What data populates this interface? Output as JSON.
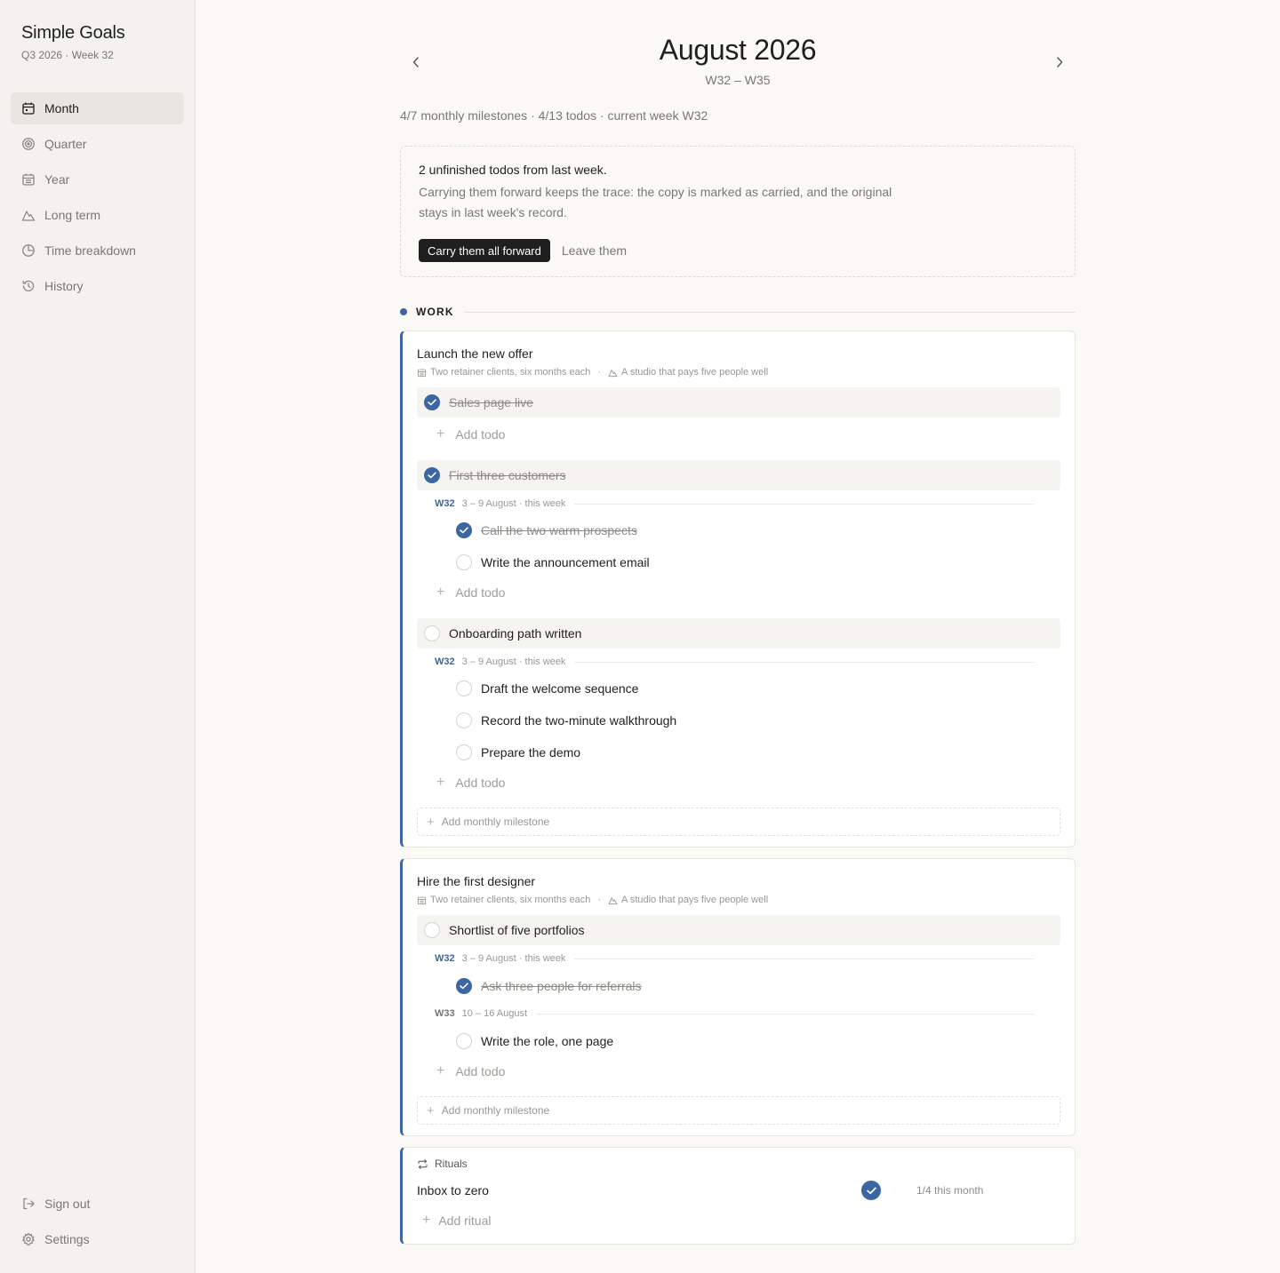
{
  "app": {
    "title": "Simple Goals",
    "subtitle": "Q3 2026 · Week 32"
  },
  "sidebar": {
    "items": [
      {
        "label": "Month",
        "icon": "calendar-icon",
        "active": true
      },
      {
        "label": "Quarter",
        "icon": "target-icon"
      },
      {
        "label": "Year",
        "icon": "calendar-grid-icon"
      },
      {
        "label": "Long term",
        "icon": "mountain-icon"
      },
      {
        "label": "Time breakdown",
        "icon": "pie-chart-icon"
      },
      {
        "label": "History",
        "icon": "history-icon"
      }
    ],
    "bottom": [
      {
        "label": "Sign out",
        "icon": "sign-out-icon"
      },
      {
        "label": "Settings",
        "icon": "gear-icon"
      }
    ]
  },
  "header": {
    "title": "August 2026",
    "weeks": "W32 – W35"
  },
  "summary": "4/7 monthly milestones · 4/13 todos · current week W32",
  "notice": {
    "title": "2 unfinished todos from last week.",
    "body": "Carrying them forward keeps the trace: the copy is marked as carried, and the original stays in last week's record.",
    "primary": "Carry them all forward",
    "secondary": "Leave them"
  },
  "section": {
    "label": "WORK",
    "color": "#3b66a3"
  },
  "goals": [
    {
      "title": "Launch the new offer",
      "meta1": "Two retainer clients, six months each",
      "meta2": "A studio that pays five people well",
      "m1": "Sales page live",
      "m2": "First three customers",
      "m2_week": {
        "code": "W32",
        "range": "3 – 9 August · this week"
      },
      "m2_todos": [
        "Call the two warm prospects",
        "Write the announcement email"
      ],
      "m3": "Onboarding path written",
      "m3_week": {
        "code": "W32",
        "range": "3 – 9 August · this week"
      },
      "m3_todos": [
        "Draft the welcome sequence",
        "Record the two-minute walkthrough",
        "Prepare the demo"
      ]
    },
    {
      "title": "Hire the first designer",
      "meta1": "Two retainer clients, six months each",
      "meta2": "A studio that pays five people well",
      "m1": "Shortlist of five portfolios",
      "w1": {
        "code": "W32",
        "range": "3 – 9 August · this week"
      },
      "w1_todos": [
        "Ask three people for referrals"
      ],
      "w2": {
        "code": "W33",
        "range": "10 – 16 August"
      },
      "w2_todos": [
        "Write the role, one page"
      ]
    }
  ],
  "labels": {
    "add_todo": "Add todo",
    "add_milestone": "Add monthly milestone",
    "add_ritual": "Add ritual"
  },
  "rituals": {
    "title": "Rituals",
    "items": [
      {
        "label": "Inbox to zero",
        "done": true,
        "progress": "1/4 this month"
      }
    ]
  }
}
